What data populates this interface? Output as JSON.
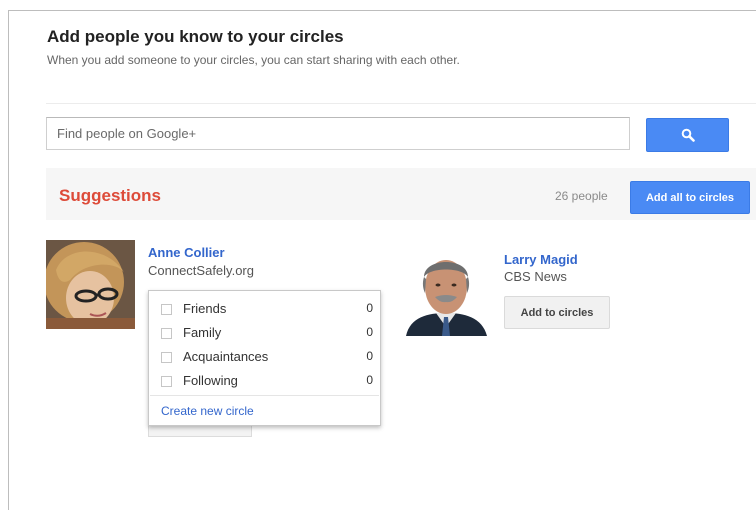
{
  "header": {
    "title": "Add people you know to your circles",
    "subtitle": "When you add someone to your circles, you can start sharing with each other."
  },
  "search": {
    "placeholder": "Find people on Google+",
    "value": "",
    "button_icon": "search-icon"
  },
  "suggestions": {
    "title": "Suggestions",
    "count_text": "26 people",
    "add_all_label": "Add all to circles"
  },
  "people": [
    {
      "name": "Anne Collier",
      "org": "ConnectSafely.org"
    },
    {
      "name": "Larry Magid",
      "org": "CBS News",
      "add_label": "Add to circles"
    }
  ],
  "circle_menu": {
    "items": [
      {
        "label": "Friends",
        "count": "0"
      },
      {
        "label": "Family",
        "count": "0"
      },
      {
        "label": "Acquaintances",
        "count": "0"
      },
      {
        "label": "Following",
        "count": "0"
      }
    ],
    "create_label": "Create new circle"
  },
  "colors": {
    "accent_blue": "#4a8af4",
    "link_blue": "#3366cc",
    "suggestions_red": "#dd4b39"
  }
}
